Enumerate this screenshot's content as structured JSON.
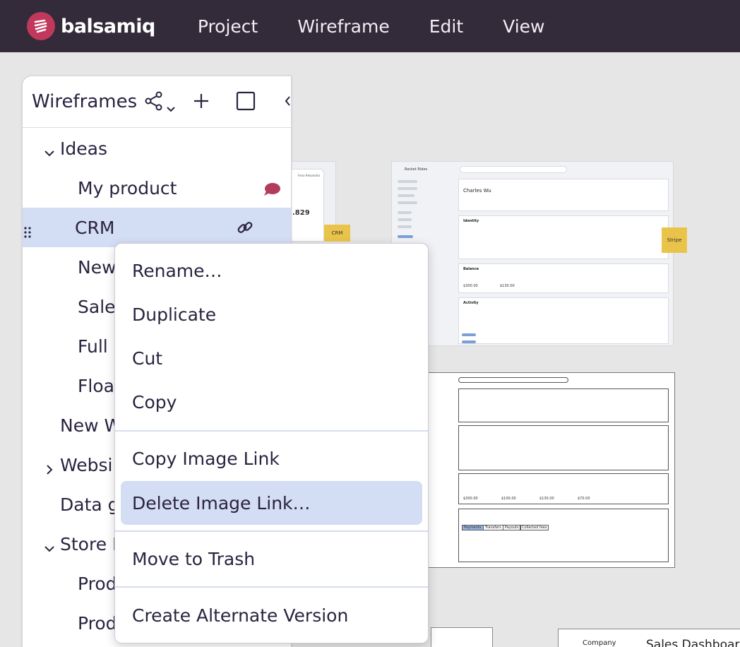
{
  "brand": {
    "name": "balsamiq",
    "color": "#c0385b"
  },
  "menubar": {
    "items": [
      "Project",
      "Wireframe",
      "Edit",
      "View"
    ]
  },
  "panel": {
    "title": "Wireframes",
    "tree": [
      {
        "label": "Ideas",
        "expanded": true
      },
      {
        "label": "My product",
        "badge": "comment-icon"
      },
      {
        "label": "CRM",
        "selected": true
      },
      {
        "label": "New"
      },
      {
        "label": "Sale"
      },
      {
        "label": "Full"
      },
      {
        "label": "Floa"
      },
      {
        "label": "New W"
      },
      {
        "label": "Websi",
        "expanded": false
      },
      {
        "label": "Data g"
      },
      {
        "label": "Store I",
        "expanded": true
      },
      {
        "label": "Prod"
      },
      {
        "label": "Prod"
      }
    ]
  },
  "context_menu": {
    "items": [
      "Rename…",
      "Duplicate",
      "Cut",
      "Copy",
      "Copy Image Link",
      "Delete Image Link…",
      "Move to Trash",
      "Create Alternate Version"
    ],
    "highlighted": "Delete Image Link…"
  },
  "canvas": {
    "sticky_notes": [
      "CRM",
      "Stripe"
    ],
    "thumb_a": {
      "app": "Rocket Rides",
      "account": "Charles Wu",
      "sections": [
        "Identity",
        "Balance",
        "Activity"
      ],
      "total_balance": "$300.00",
      "available": "$130.00"
    },
    "thumb_b": {
      "sections": [
        "Payments",
        "Transfers",
        "Payouts",
        "Collected fees"
      ],
      "values": [
        "$300.00",
        "$100.00",
        "$130.00",
        "$70.00"
      ]
    },
    "bottom_labels": [
      "Company",
      "Sales Dashboard"
    ],
    "profile_card": {
      "name": "Fena Alexandra",
      "value": ".829"
    }
  },
  "colors": {
    "topbar": "#332b3a",
    "selection": "#d3ddf3",
    "sticky": "#eac44a"
  }
}
